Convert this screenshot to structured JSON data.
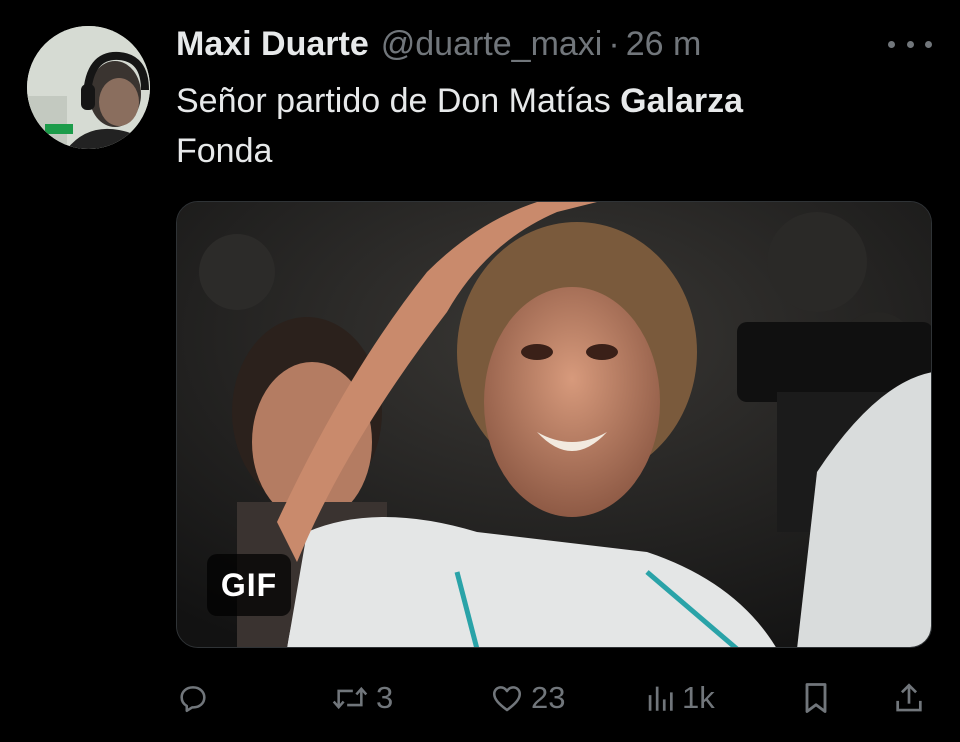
{
  "author": {
    "display_name": "Maxi Duarte",
    "handle": "@duarte_maxi",
    "separator": "·",
    "time": "26 m"
  },
  "tweet": {
    "text_line1_prefix": "Señor partido de Don Matías ",
    "text_line1_bold": "Galarza",
    "text_line2": "Fonda"
  },
  "media": {
    "badge": "GIF"
  },
  "actions": {
    "reply_count": "",
    "retweet_count": "3",
    "like_count": "23",
    "views_count": "1k"
  },
  "colors": {
    "background": "#000000",
    "primary_text": "#e7e9ea",
    "secondary_text": "#71767b"
  },
  "icons": {
    "more": "more-horizontal-icon",
    "reply": "reply-icon",
    "retweet": "retweet-icon",
    "like": "heart-icon",
    "views": "views-chart-icon",
    "bookmark": "bookmark-icon",
    "share": "share-icon"
  }
}
